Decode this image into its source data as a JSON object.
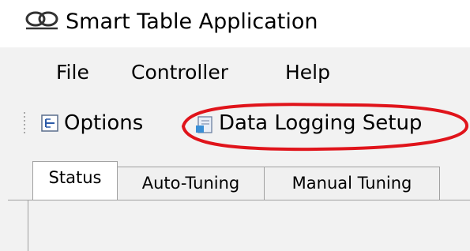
{
  "window": {
    "title": "Smart Table Application"
  },
  "menu": {
    "items": [
      "File",
      "Controller",
      "Help"
    ]
  },
  "toolbar": {
    "options_label": "Options",
    "data_logging_label": "Data Logging Setup"
  },
  "tabs": [
    {
      "label": "Status",
      "selected": true
    },
    {
      "label": "Auto-Tuning",
      "selected": false
    },
    {
      "label": "Manual Tuning",
      "selected": false
    }
  ],
  "annotation": {
    "color": "#e0141b"
  }
}
